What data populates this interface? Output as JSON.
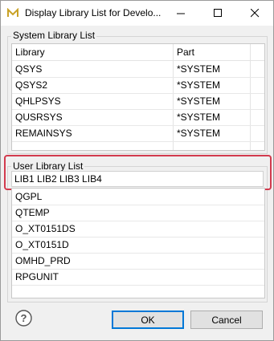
{
  "window": {
    "title": "Display Library List for Develo..."
  },
  "system_group": {
    "label": "System Library List",
    "columns": [
      "Library",
      "Part"
    ],
    "rows": [
      [
        "QSYS",
        "*SYSTEM"
      ],
      [
        "QSYS2",
        "*SYSTEM"
      ],
      [
        "QHLPSYS",
        "*SYSTEM"
      ],
      [
        "QUSRSYS",
        "*SYSTEM"
      ],
      [
        "REMAINSYS",
        "*SYSTEM"
      ]
    ]
  },
  "user_group": {
    "label": "User Library List",
    "input_value": "LIB1 LIB2 LIB3 LIB4",
    "items": [
      "QGPL",
      "QTEMP",
      "O_XT0151DS",
      "O_XT0151D",
      "OMHD_PRD",
      "RPGUNIT"
    ]
  },
  "buttons": {
    "ok": "OK",
    "cancel": "Cancel"
  },
  "colors": {
    "highlight": "#d23b4e",
    "accent": "#0078d7"
  },
  "icons": [
    "app-icon",
    "minimize-icon",
    "maximize-icon",
    "close-icon",
    "help-icon"
  ]
}
